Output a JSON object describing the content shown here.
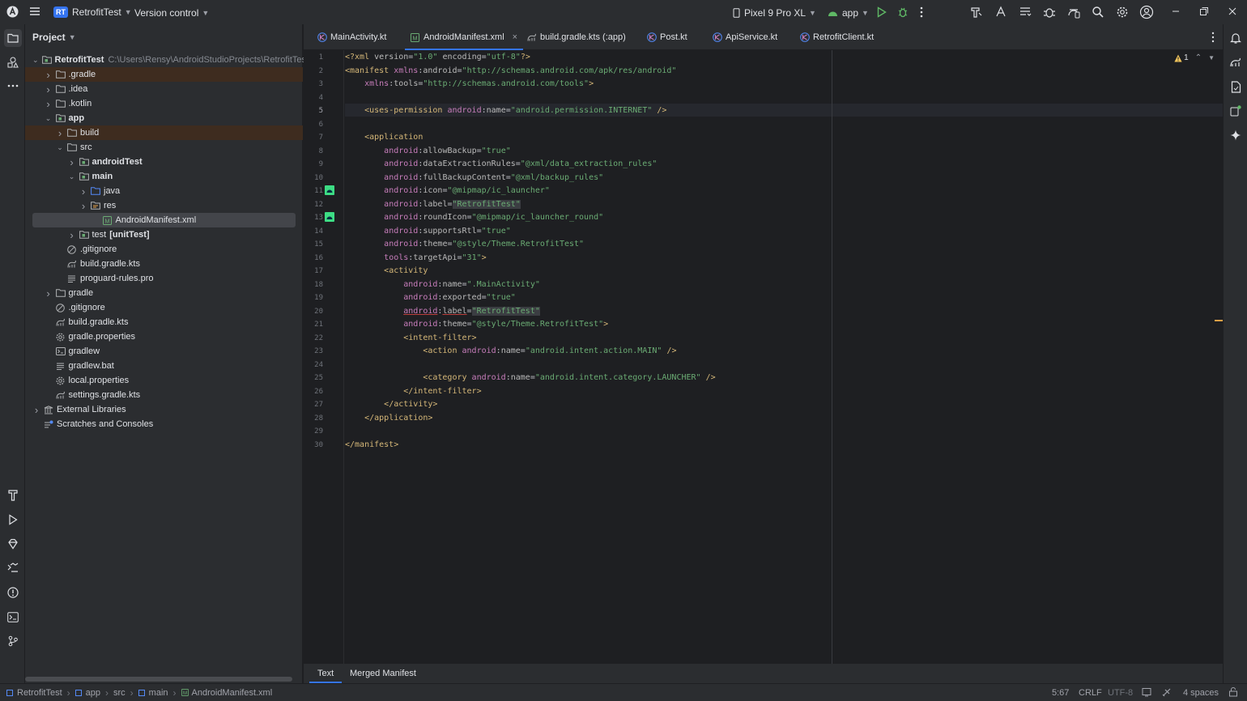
{
  "topbar": {
    "project_initials": "RT",
    "project_name": "RetrofitTest",
    "vcs_label": "Version control",
    "device": "Pixel 9 Pro XL",
    "run_config": "app"
  },
  "project_panel": {
    "title": "Project",
    "tree": [
      {
        "label": "RetrofitTest",
        "hint": "C:\\Users\\Rensy\\AndroidStudioProjects\\RetrofitTest",
        "icon": "module-folder-icon",
        "bold": true,
        "expanded": true
      },
      {
        "label": ".gradle",
        "icon": "folder-icon",
        "expanded": false
      },
      {
        "label": ".idea",
        "icon": "folder-icon",
        "expanded": false
      },
      {
        "label": ".kotlin",
        "icon": "folder-icon",
        "expanded": false
      },
      {
        "label": "app",
        "icon": "module-folder-icon",
        "bold": true,
        "expanded": true
      },
      {
        "label": "build",
        "icon": "folder-icon",
        "expanded": false
      },
      {
        "label": "src",
        "icon": "folder-icon",
        "expanded": true
      },
      {
        "label": "androidTest",
        "icon": "module-folder-icon",
        "bold": true,
        "expanded": false
      },
      {
        "label": "main",
        "icon": "module-folder-icon",
        "bold": true,
        "expanded": true
      },
      {
        "label": "java",
        "icon": "source-folder-icon",
        "expanded": false
      },
      {
        "label": "res",
        "icon": "resource-folder-icon",
        "expanded": false
      },
      {
        "label": "AndroidManifest.xml",
        "icon": "manifest-file-icon"
      },
      {
        "label": "test",
        "label2": "[unitTest]",
        "icon": "module-folder-icon",
        "expanded": false
      },
      {
        "label": ".gitignore",
        "icon": "ignore-file-icon"
      },
      {
        "label": "build.gradle.kts",
        "icon": "gradle-file-icon"
      },
      {
        "label": "proguard-rules.pro",
        "icon": "text-file-icon"
      },
      {
        "label": "gradle",
        "icon": "folder-icon",
        "expanded": false
      },
      {
        "label": ".gitignore",
        "icon": "ignore-file-icon"
      },
      {
        "label": "build.gradle.kts",
        "icon": "gradle-file-icon"
      },
      {
        "label": "gradle.properties",
        "icon": "settings-file-icon"
      },
      {
        "label": "gradlew",
        "icon": "terminal-file-icon"
      },
      {
        "label": "gradlew.bat",
        "icon": "text-file-icon"
      },
      {
        "label": "local.properties",
        "icon": "settings-file-icon"
      },
      {
        "label": "settings.gradle.kts",
        "icon": "gradle-file-icon"
      },
      {
        "label": "External Libraries",
        "icon": "library-icon",
        "expanded": false
      },
      {
        "label": "Scratches and Consoles",
        "icon": "scratches-icon"
      }
    ]
  },
  "tabs": [
    {
      "label": "MainActivity.kt",
      "icon": "kotlin-file-icon"
    },
    {
      "label": "AndroidManifest.xml",
      "icon": "manifest-file-icon",
      "active": true
    },
    {
      "label": "build.gradle.kts (:app)",
      "icon": "gradle-file-icon"
    },
    {
      "label": "Post.kt",
      "icon": "kotlin-file-icon"
    },
    {
      "label": "ApiService.kt",
      "icon": "kotlin-file-icon"
    },
    {
      "label": "RetrofitClient.kt",
      "icon": "kotlin-file-icon"
    }
  ],
  "editor": {
    "warning_count": "1",
    "current_line": 5,
    "lines": [
      "<?xml version=\"1.0\" encoding=\"utf-8\"?>",
      "<manifest xmlns:android=\"http://schemas.android.com/apk/res/android\"",
      "    xmlns:tools=\"http://schemas.android.com/tools\">",
      "",
      "    <uses-permission android:name=\"android.permission.INTERNET\" />",
      "",
      "    <application",
      "        android:allowBackup=\"true\"",
      "        android:dataExtractionRules=\"@xml/data_extraction_rules\"",
      "        android:fullBackupContent=\"@xml/backup_rules\"",
      "        android:icon=\"@mipmap/ic_launcher\"",
      "        android:label=\"RetrofitTest\"",
      "        android:roundIcon=\"@mipmap/ic_launcher_round\"",
      "        android:supportsRtl=\"true\"",
      "        android:theme=\"@style/Theme.RetrofitTest\"",
      "        tools:targetApi=\"31\">",
      "        <activity",
      "            android:name=\".MainActivity\"",
      "            android:exported=\"true\"",
      "            android:label=\"RetrofitTest\"",
      "            android:theme=\"@style/Theme.RetrofitTest\">",
      "            <intent-filter>",
      "                <action android:name=\"android.intent.action.MAIN\" />",
      "",
      "                <category android:name=\"android.intent.category.LAUNCHER\" />",
      "            </intent-filter>",
      "        </activity>",
      "    </application>",
      "",
      "</manifest>"
    ]
  },
  "bottom_tabs": [
    {
      "label": "Text",
      "active": true
    },
    {
      "label": "Merged Manifest"
    }
  ],
  "statusbar": {
    "breadcrumbs": [
      "RetrofitTest",
      "app",
      "src",
      "main",
      "AndroidManifest.xml"
    ],
    "position": "5:67",
    "line_ending": "CRLF",
    "encoding": "UTF-8",
    "indent": "4 spaces"
  },
  "colors": {
    "accent": "#3574f0",
    "tag": "#d5b778",
    "namespace": "#c77dbb",
    "string": "#6aab73",
    "warning": "#f2c55c"
  }
}
